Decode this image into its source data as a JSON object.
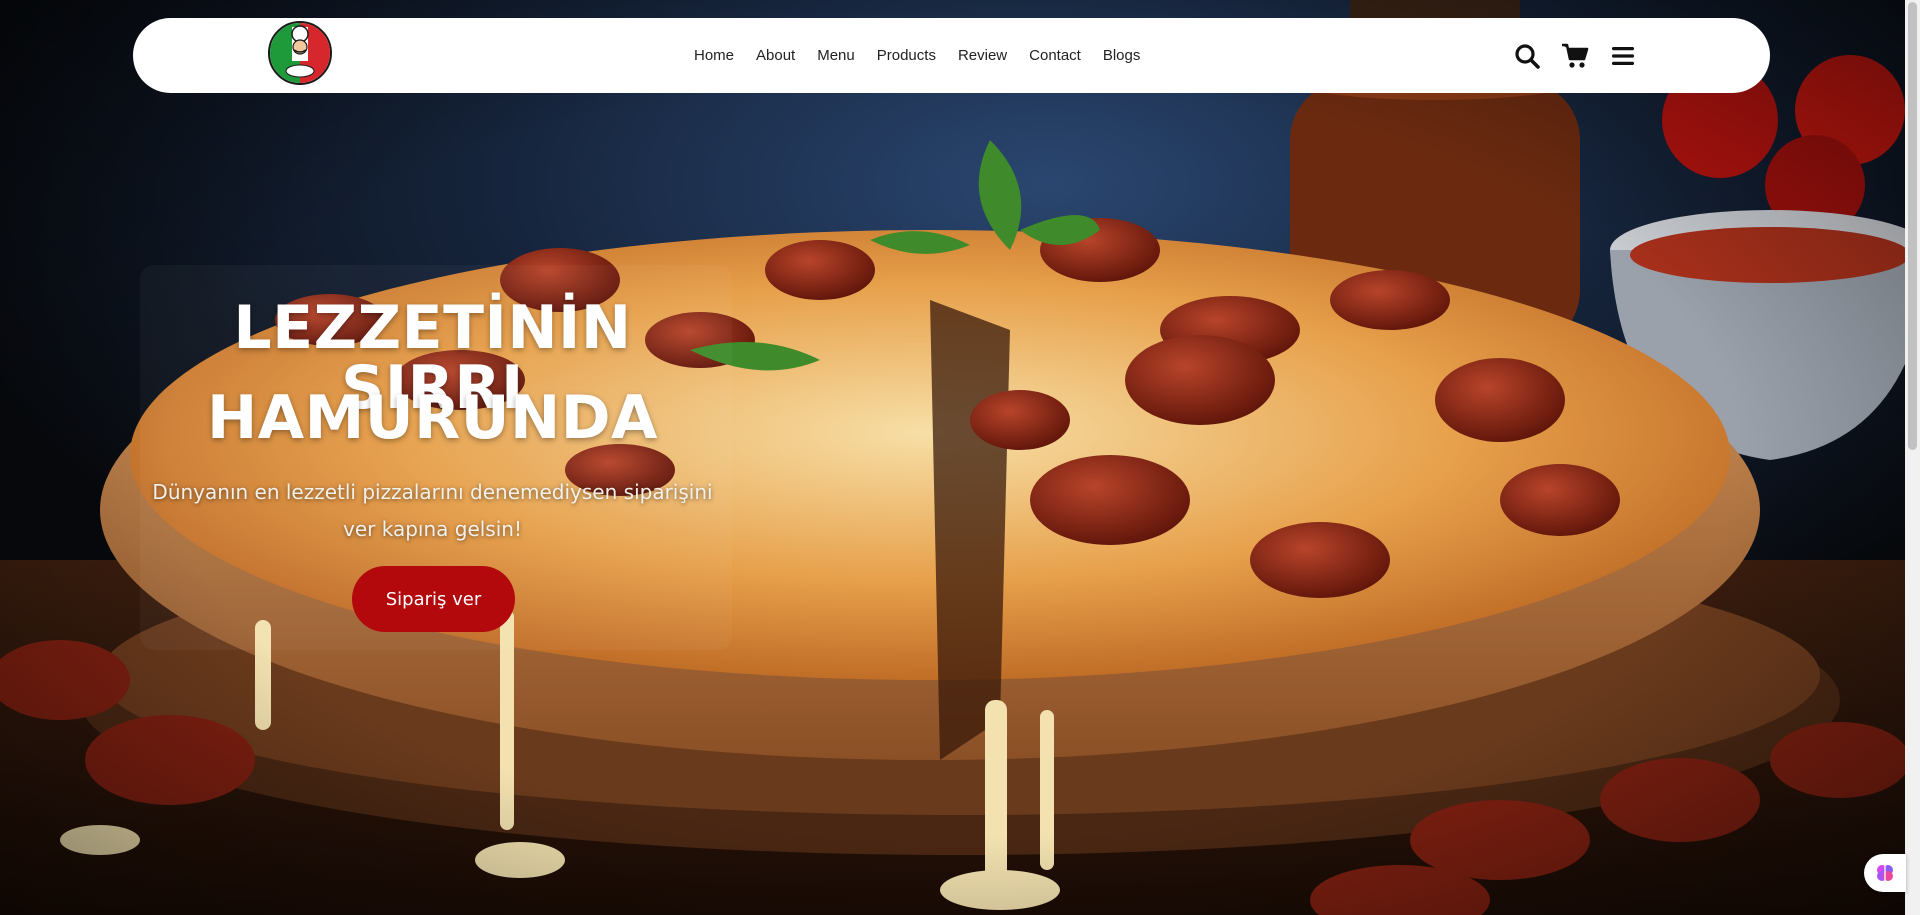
{
  "nav": {
    "logo_alt": "Pizza",
    "links": [
      {
        "label": "Home"
      },
      {
        "label": "About"
      },
      {
        "label": "Menu"
      },
      {
        "label": "Products"
      },
      {
        "label": "Review"
      },
      {
        "label": "Contact"
      },
      {
        "label": "Blogs"
      }
    ],
    "icons": [
      "search-icon",
      "cart-icon",
      "menu-icon"
    ]
  },
  "hero": {
    "title_line1": "LEZZETİNİN SIRRI",
    "title_line2": "HAMURUNDA",
    "subtitle": "Dünyanın en lezzetli pizzalarını denemediysen siparişini ver kapına gelsin!",
    "button_label": "Sipariş ver"
  },
  "colors": {
    "accent": "#b3080c",
    "navbar_bg": "#ffffff",
    "text_light": "#ffffff"
  }
}
